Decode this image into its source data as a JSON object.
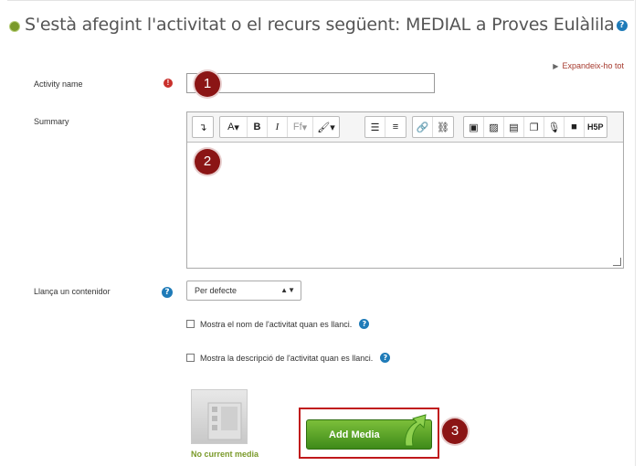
{
  "heading": {
    "text": "S'està afegint l'activitat o el recurs següent: MEDIAL a Proves Eulàlila",
    "help": "?"
  },
  "expand_link": {
    "label": "Expandeix-ho tot"
  },
  "activity_name": {
    "label": "Activity name",
    "required_icon": "!",
    "value": ""
  },
  "summary": {
    "label": "Summary",
    "toolbar": {
      "groups": [
        [
          "collapse"
        ],
        [
          "A",
          "B",
          "I",
          "Ff",
          "paint-brush"
        ],
        [
          "bullet-list",
          "numbered-list"
        ],
        [
          "link",
          "unlink"
        ],
        [
          "word-icon",
          "image-icon",
          "media-icon",
          "manage-files-icon",
          "microphone-icon",
          "video-icon",
          "H5P"
        ]
      ],
      "labels": {
        "A": "A",
        "B": "B",
        "I": "I",
        "Ff": "Ff",
        "H5P": "H5P"
      }
    },
    "value": ""
  },
  "launch": {
    "label": "Llança un contenidor",
    "help": "?",
    "selected": "Per defecte"
  },
  "checkbox_name": {
    "label": "Mostra el nom de l'activitat quan es llanci.",
    "checked": false,
    "help": "?"
  },
  "checkbox_desc": {
    "label": "Mostra la descripció de l'activitat quan es llanci.",
    "checked": false,
    "help": "?"
  },
  "media": {
    "no_current": "No current media",
    "button_label": "Add Media"
  },
  "badges": {
    "one": "1",
    "two": "2",
    "three": "3"
  },
  "colors": {
    "badge": "#8b1515",
    "accent_green": "#7a9a2a",
    "button_green": "#4e9c20",
    "help_blue": "#1f7bb8",
    "required_red": "#c9302c"
  }
}
